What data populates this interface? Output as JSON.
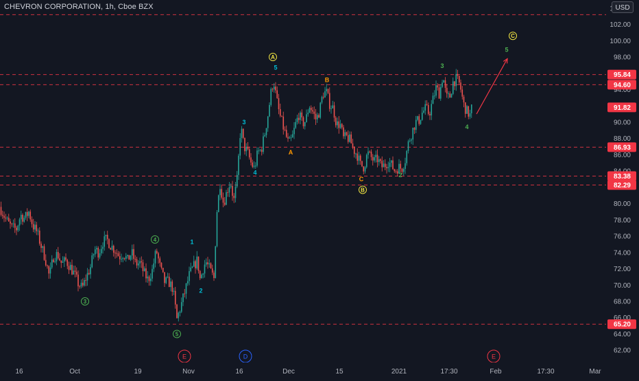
{
  "header": {
    "title": "CHEVRON CORPORATION, 1h, Cboe BZX",
    "currency": "USD"
  },
  "chart_data": {
    "type": "candlestick",
    "title": "CHEVRON CORPORATION, 1h, Cboe BZX",
    "ylim": [
      60.5,
      105
    ],
    "y_ticks": [
      "62.00",
      "64.00",
      "66.00",
      "68.00",
      "70.00",
      "72.00",
      "74.00",
      "76.00",
      "78.00",
      "80.00",
      "82.00",
      "84.00",
      "86.00",
      "88.00",
      "90.00",
      "92.00",
      "94.00",
      "96.00",
      "98.00",
      "100.00",
      "102.00",
      "104.00"
    ],
    "x_ticks": [
      "16",
      "Oct",
      "19",
      "Nov",
      "16",
      "Dec",
      "15",
      "2021",
      "17:30",
      "Feb",
      "17:30",
      "Mar"
    ],
    "grid": false,
    "price_lines": [
      {
        "value": 103.2,
        "label": ""
      },
      {
        "value": 95.84,
        "label": "95.84"
      },
      {
        "value": 94.6,
        "label": "94.60"
      },
      {
        "value": 86.93,
        "label": "86.93"
      },
      {
        "value": 83.38,
        "label": "83.38"
      },
      {
        "value": 82.29,
        "label": "82.29"
      },
      {
        "value": 65.2,
        "label": "65.20"
      }
    ],
    "last_price": {
      "value": 91.82,
      "label": "91.82"
    },
    "price_path": [
      [
        0,
        79.6
      ],
      [
        6,
        78.5
      ],
      [
        12,
        77.6
      ],
      [
        18,
        77.0
      ],
      [
        24,
        76.9
      ],
      [
        30,
        78.6
      ],
      [
        36,
        78.2
      ],
      [
        42,
        79.0
      ],
      [
        48,
        77.3
      ],
      [
        54,
        76.5
      ],
      [
        60,
        74.8
      ],
      [
        66,
        73.3
      ],
      [
        72,
        71.0
      ],
      [
        78,
        73.5
      ],
      [
        84,
        73.8
      ],
      [
        90,
        72.6
      ],
      [
        96,
        73.0
      ],
      [
        102,
        72.3
      ],
      [
        108,
        71.4
      ],
      [
        114,
        70.2
      ],
      [
        120,
        69.6
      ],
      [
        126,
        71.0
      ],
      [
        132,
        72.2
      ],
      [
        138,
        74.4
      ],
      [
        144,
        74.0
      ],
      [
        150,
        75.3
      ],
      [
        156,
        75.6
      ],
      [
        162,
        74.8
      ],
      [
        168,
        74.3
      ],
      [
        174,
        73.5
      ],
      [
        180,
        73.9
      ],
      [
        186,
        73.0
      ],
      [
        192,
        74.0
      ],
      [
        198,
        72.6
      ],
      [
        204,
        72.7
      ],
      [
        210,
        71.5
      ],
      [
        216,
        70.6
      ],
      [
        222,
        71.8
      ],
      [
        228,
        74.3
      ],
      [
        234,
        72.0
      ],
      [
        240,
        70.4
      ],
      [
        246,
        70.4
      ],
      [
        252,
        69.6
      ],
      [
        258,
        65.8
      ],
      [
        264,
        67.5
      ],
      [
        270,
        69.3
      ],
      [
        276,
        71.2
      ],
      [
        282,
        72.2
      ],
      [
        288,
        73.1
      ],
      [
        292,
        70.6
      ],
      [
        296,
        72.0
      ],
      [
        300,
        72.9
      ],
      [
        306,
        71.9
      ],
      [
        312,
        70.8
      ],
      [
        316,
        78.8
      ],
      [
        321,
        82.5
      ],
      [
        326,
        80.0
      ],
      [
        331,
        81.5
      ],
      [
        336,
        82.8
      ],
      [
        341,
        80.3
      ],
      [
        346,
        83.0
      ],
      [
        351,
        89.5
      ],
      [
        356,
        87.0
      ],
      [
        361,
        86.3
      ],
      [
        366,
        85.0
      ],
      [
        371,
        84.3
      ],
      [
        376,
        86.3
      ],
      [
        381,
        86.6
      ],
      [
        386,
        88.5
      ],
      [
        391,
        91.0
      ],
      [
        395,
        93.5
      ],
      [
        399,
        95.2
      ],
      [
        403,
        93.0
      ],
      [
        407,
        91.2
      ],
      [
        411,
        90.0
      ],
      [
        416,
        88.6
      ],
      [
        421,
        87.3
      ],
      [
        426,
        88.0
      ],
      [
        431,
        89.7
      ],
      [
        436,
        91.0
      ],
      [
        441,
        89.8
      ],
      [
        446,
        90.2
      ],
      [
        451,
        92.1
      ],
      [
        456,
        91.3
      ],
      [
        461,
        90.3
      ],
      [
        466,
        91.4
      ],
      [
        471,
        93.5
      ],
      [
        476,
        93.7
      ],
      [
        481,
        92.2
      ],
      [
        486,
        91.7
      ],
      [
        491,
        89.7
      ],
      [
        496,
        89.8
      ],
      [
        501,
        88.0
      ],
      [
        506,
        88.2
      ],
      [
        511,
        87.7
      ],
      [
        516,
        86.6
      ],
      [
        521,
        86.0
      ],
      [
        526,
        84.7
      ],
      [
        531,
        84.5
      ],
      [
        536,
        86.2
      ],
      [
        541,
        85.7
      ],
      [
        546,
        85.2
      ],
      [
        551,
        85.5
      ],
      [
        556,
        84.5
      ],
      [
        561,
        84.7
      ],
      [
        566,
        85.2
      ],
      [
        571,
        84.7
      ],
      [
        576,
        84.0
      ],
      [
        581,
        84.5
      ],
      [
        586,
        84.3
      ],
      [
        591,
        85.4
      ],
      [
        596,
        87.6
      ],
      [
        601,
        88.8
      ],
      [
        606,
        90.0
      ],
      [
        611,
        90.2
      ],
      [
        616,
        91.2
      ],
      [
        621,
        91.7
      ],
      [
        626,
        91.0
      ],
      [
        631,
        92.6
      ],
      [
        636,
        94.2
      ],
      [
        641,
        93.5
      ],
      [
        646,
        95.8
      ],
      [
        651,
        93.0
      ],
      [
        656,
        93.1
      ],
      [
        661,
        95.0
      ],
      [
        666,
        95.3
      ],
      [
        671,
        94.5
      ],
      [
        676,
        92.2
      ],
      [
        681,
        91.3
      ],
      [
        686,
        90.8
      ],
      [
        688,
        91.8
      ]
    ],
    "projection": {
      "from": [
        695,
        91.0
      ],
      "to": [
        740,
        97.8
      ]
    },
    "wave_labels": [
      {
        "text": "A",
        "style": "circle",
        "color": "#f0e442",
        "x": 398,
        "y": 98.0
      },
      {
        "text": "5",
        "style": "plain",
        "color": "#00bcd4",
        "x": 402,
        "y": 96.7
      },
      {
        "text": "3",
        "style": "plain",
        "color": "#00bcd4",
        "x": 356,
        "y": 90.0
      },
      {
        "text": "4",
        "style": "plain",
        "color": "#00bcd4",
        "x": 372,
        "y": 83.8
      },
      {
        "text": "A",
        "style": "plain",
        "color": "#ff9800",
        "x": 424,
        "y": 86.3
      },
      {
        "text": "B",
        "style": "plain",
        "color": "#ff9800",
        "x": 477,
        "y": 95.2
      },
      {
        "text": "C",
        "style": "plain",
        "color": "#ff9800",
        "x": 527,
        "y": 83.0
      },
      {
        "text": "B",
        "style": "circle",
        "color": "#f0e442",
        "x": 529,
        "y": 81.7
      },
      {
        "text": "2",
        "style": "plain",
        "color": "#4caf50",
        "x": 584,
        "y": 83.5
      },
      {
        "text": "3",
        "style": "plain",
        "color": "#4caf50",
        "x": 645,
        "y": 96.9
      },
      {
        "text": "4",
        "style": "plain",
        "color": "#4caf50",
        "x": 681,
        "y": 89.4
      },
      {
        "text": "5",
        "style": "plain",
        "color": "#4caf50",
        "x": 739,
        "y": 98.9
      },
      {
        "text": "C",
        "style": "circle",
        "color": "#f0e442",
        "x": 748,
        "y": 100.6
      },
      {
        "text": "4",
        "style": "circle",
        "color": "#4caf50",
        "x": 226,
        "y": 75.6
      },
      {
        "text": "3",
        "style": "circle",
        "color": "#4caf50",
        "x": 124,
        "y": 68.0
      },
      {
        "text": "5",
        "style": "circle",
        "color": "#4caf50",
        "x": 258,
        "y": 64.0
      },
      {
        "text": "1",
        "style": "plain",
        "color": "#00bcd4",
        "x": 280,
        "y": 75.3
      },
      {
        "text": "2",
        "style": "plain",
        "color": "#00bcd4",
        "x": 293,
        "y": 69.3
      }
    ],
    "event_markers": [
      {
        "text": "E",
        "color": "#f23645",
        "x": 269
      },
      {
        "text": "D",
        "color": "#2962ff",
        "x": 358
      },
      {
        "text": "E",
        "color": "#f23645",
        "x": 720
      }
    ]
  },
  "colors": {
    "background": "#131722",
    "up": "#26a69a",
    "down": "#ef5350",
    "price_line": "#f23645",
    "axis_text": "#b2b5be",
    "projection": "#f23645"
  }
}
